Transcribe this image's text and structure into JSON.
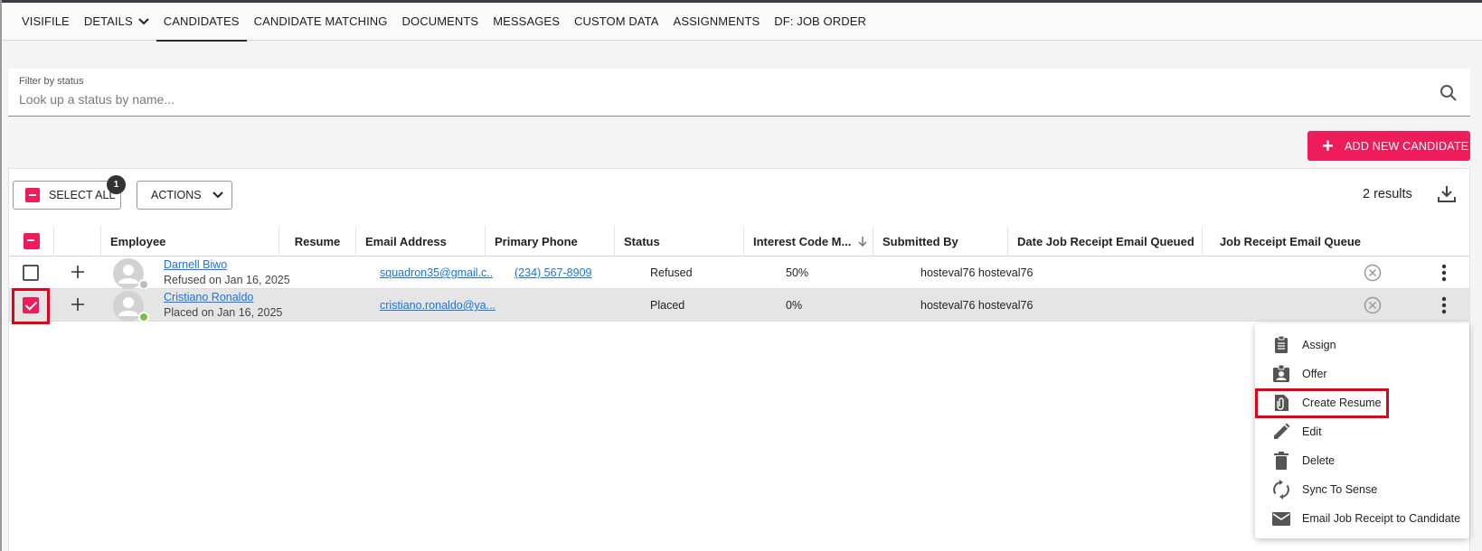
{
  "tabs": [
    {
      "label": "VISIFILE"
    },
    {
      "label": "DETAILS"
    },
    {
      "label": "CANDIDATES"
    },
    {
      "label": "CANDIDATE MATCHING"
    },
    {
      "label": "DOCUMENTS"
    },
    {
      "label": "MESSAGES"
    },
    {
      "label": "CUSTOM DATA"
    },
    {
      "label": "ASSIGNMENTS"
    },
    {
      "label": "DF: JOB ORDER"
    }
  ],
  "active_tab": "CANDIDATES",
  "filter": {
    "label": "Filter by status",
    "placeholder": "Look up a status by name..."
  },
  "add_button_label": "ADD NEW CANDIDATE",
  "toolbar": {
    "select_all_label": "SELECT ALL",
    "selected_count": "1",
    "actions_label": "ACTIONS",
    "results_text": "2 results"
  },
  "columns": {
    "employee": "Employee",
    "resume": "Resume",
    "email": "Email Address",
    "phone": "Primary Phone",
    "status": "Status",
    "interest": "Interest Code M...",
    "submitted_by": "Submitted By",
    "date_queued": "Date Job Receipt Email Queued",
    "receipt_queued": "Job Receipt Email Queue"
  },
  "rows": [
    {
      "name": "Darnell Biwo",
      "sub": "Refused on Jan 16, 2025",
      "email": "squadron35@gmail.c...",
      "phone": "(234) 567-8909",
      "status": "Refused",
      "interest": "50%",
      "submitted_by": "hosteval76 hosteval76",
      "checked": false,
      "presence_color": "#bdbdbd"
    },
    {
      "name": "Cristiano Ronaldo",
      "sub": "Placed on Jan 16, 2025",
      "email": "cristiano.ronaldo@ya...",
      "phone": "",
      "status": "Placed",
      "interest": "0%",
      "submitted_by": "hosteval76 hosteval76",
      "checked": true,
      "presence_color": "#7cc242"
    }
  ],
  "menu": [
    {
      "label": "Assign",
      "icon": "clipboard-icon"
    },
    {
      "label": "Offer",
      "icon": "badge-icon"
    },
    {
      "label": "Create Resume",
      "icon": "file-attachment-icon"
    },
    {
      "label": "Edit",
      "icon": "pencil-icon"
    },
    {
      "label": "Delete",
      "icon": "trash-icon"
    },
    {
      "label": "Sync To Sense",
      "icon": "sync-icon"
    },
    {
      "label": "Email Job Receipt to Candidate",
      "icon": "envelope-icon"
    }
  ],
  "colors": {
    "accent": "#ee1c5a",
    "highlight": "#e2001a",
    "link": "#1a73e8"
  }
}
